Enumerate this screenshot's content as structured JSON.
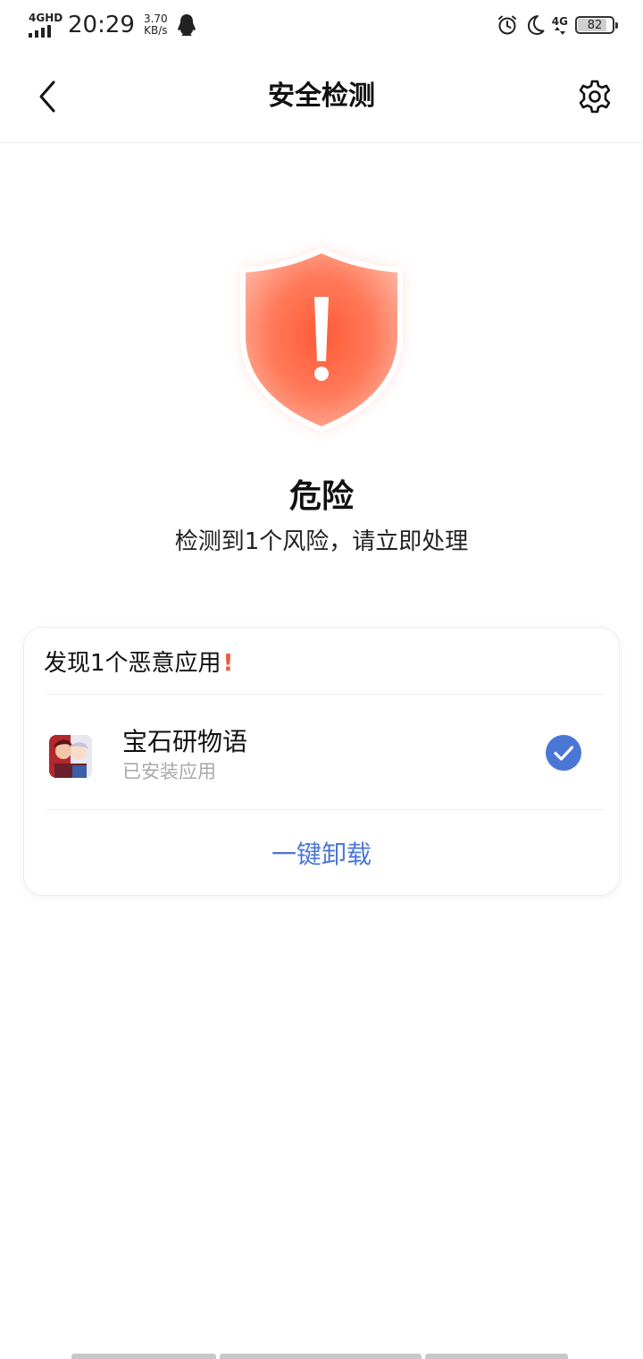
{
  "status_bar": {
    "network_tag": "4GHD",
    "time": "20:29",
    "speed_value": "3.70",
    "speed_unit": "KB/s",
    "network_right": "4G",
    "battery": "82"
  },
  "nav": {
    "title": "安全检测"
  },
  "status": {
    "title": "危险",
    "description": "检测到1个风险，请立即处理",
    "shield_color": "#ff6b4a"
  },
  "card": {
    "header": "发现1个恶意应用",
    "header_mark": "!",
    "apps": [
      {
        "name": "宝石研物语",
        "subtitle": "已安装应用",
        "checked": true
      }
    ],
    "action_label": "一键卸载",
    "accent_color": "#4a76d6"
  },
  "icons": {
    "back": "chevron-left-icon",
    "settings": "gear-icon",
    "shield": "shield-warning-icon",
    "check": "check-circle-icon"
  }
}
